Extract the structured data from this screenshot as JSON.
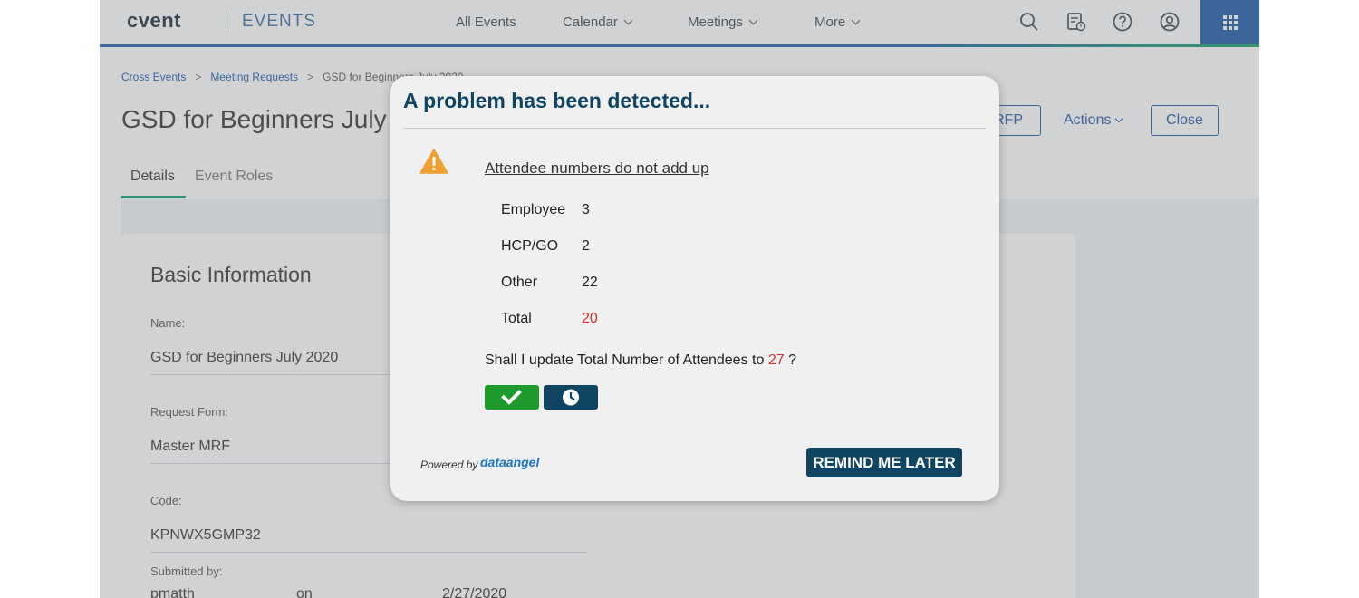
{
  "nav": {
    "logo": "cvent",
    "product": "EVENTS",
    "items": [
      {
        "label": "All Events"
      },
      {
        "label": "Calendar"
      },
      {
        "label": "Meetings"
      },
      {
        "label": "More"
      }
    ],
    "icons": [
      "search-icon",
      "event-calendar-icon",
      "help-icon",
      "user-profile-icon",
      "apps-grid-icon"
    ],
    "accent_color": "#1b5aa6"
  },
  "breadcrumb": {
    "items": [
      "Cross Events",
      "Meeting Requests",
      "GSD for Beginners July 2020"
    ]
  },
  "page": {
    "title": "GSD for Beginners July 2020",
    "rfp_label": "RFP",
    "actions_label": "Actions",
    "close_label": "Close"
  },
  "tabs": [
    {
      "label": "Details",
      "active": true
    },
    {
      "label": "Event Roles",
      "active": false
    }
  ],
  "card": {
    "title": "Basic Information",
    "fields": [
      {
        "label": "Name:",
        "value": "GSD for Beginners July 2020"
      },
      {
        "label": "Request Form:",
        "value": "Master MRF"
      },
      {
        "label": "Code:",
        "value": "KPNWX5GMP32"
      }
    ],
    "submitted_label": "Submitted by:",
    "submitted_by": "pmatth",
    "submitted_on_label": "on",
    "submitted_date": "2/27/2020"
  },
  "modal": {
    "title": "A problem has been detected...",
    "problem": "Attendee numbers do not add up",
    "rows": [
      {
        "label": "Employee",
        "value": "3"
      },
      {
        "label": "HCP/GO",
        "value": "2"
      },
      {
        "label": "Other",
        "value": "22"
      },
      {
        "label": "Total",
        "value": "20"
      }
    ],
    "question_prefix": "Shall I update Total Number of Attendees to",
    "question_value": "27",
    "question_suffix": "?",
    "powered_by": "Powered by",
    "powered_logo": "dataangel",
    "remind_label": "REMIND ME LATER",
    "colors": {
      "title": "#0f4563",
      "ok": "#1f9a2c",
      "alert": "#d03030",
      "warning": "#f0a030"
    }
  }
}
